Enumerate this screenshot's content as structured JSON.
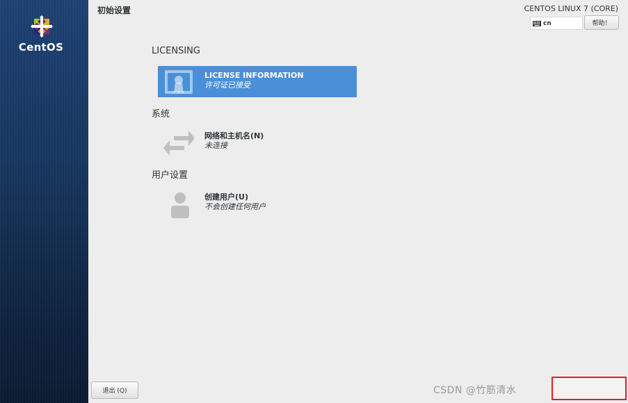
{
  "brand": {
    "logo_text": "CentOS"
  },
  "header": {
    "page_title": "初始设置",
    "product_title": "CENTOS LINUX 7 (CORE)",
    "keyboard_layout": "cn",
    "help_label": "帮助！"
  },
  "sections": [
    {
      "title": "LICENSING",
      "spokes": [
        {
          "name": "LICENSE INFORMATION",
          "status": "许可证已接受",
          "icon": "license-icon",
          "selected": true
        }
      ]
    },
    {
      "title": "系统",
      "spokes": [
        {
          "name": "网络和主机名(N)",
          "status": "未连接",
          "icon": "network-arrows-icon",
          "selected": false
        }
      ]
    },
    {
      "title": "用户设置",
      "spokes": [
        {
          "name": "创建用户(U)",
          "status": "不会创建任何用户",
          "icon": "user-icon",
          "selected": false
        }
      ]
    }
  ],
  "footer": {
    "quit_label": "退出 (Q)"
  },
  "watermark": "CSDN @竹筋清水",
  "colors": {
    "selected_spoke": "#4a90d9",
    "sidebar": "#17375f",
    "finish_highlight": "#e51c23"
  }
}
